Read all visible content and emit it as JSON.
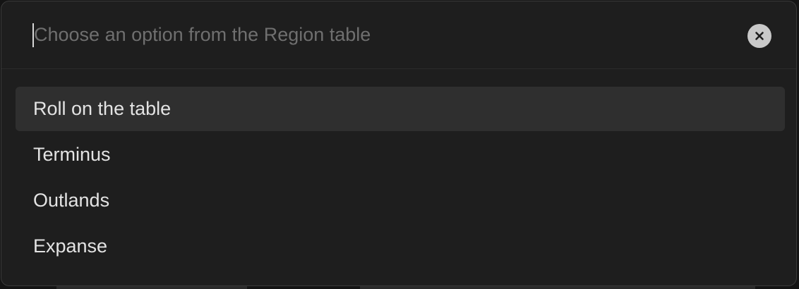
{
  "prompt": {
    "value": "",
    "placeholder": "Choose an option from the Region table"
  },
  "clear_button": {
    "icon": "close-icon"
  },
  "suggestions": [
    {
      "label": "Roll on the table",
      "selected": true
    },
    {
      "label": "Terminus",
      "selected": false
    },
    {
      "label": "Outlands",
      "selected": false
    },
    {
      "label": "Expanse",
      "selected": false
    }
  ],
  "colors": {
    "modal_background": "#1e1e1e",
    "selected_background": "#2f2f2f",
    "text": "#e3e3e3",
    "placeholder": "#6f6f6f",
    "clear_button": "#c9c9c9"
  }
}
